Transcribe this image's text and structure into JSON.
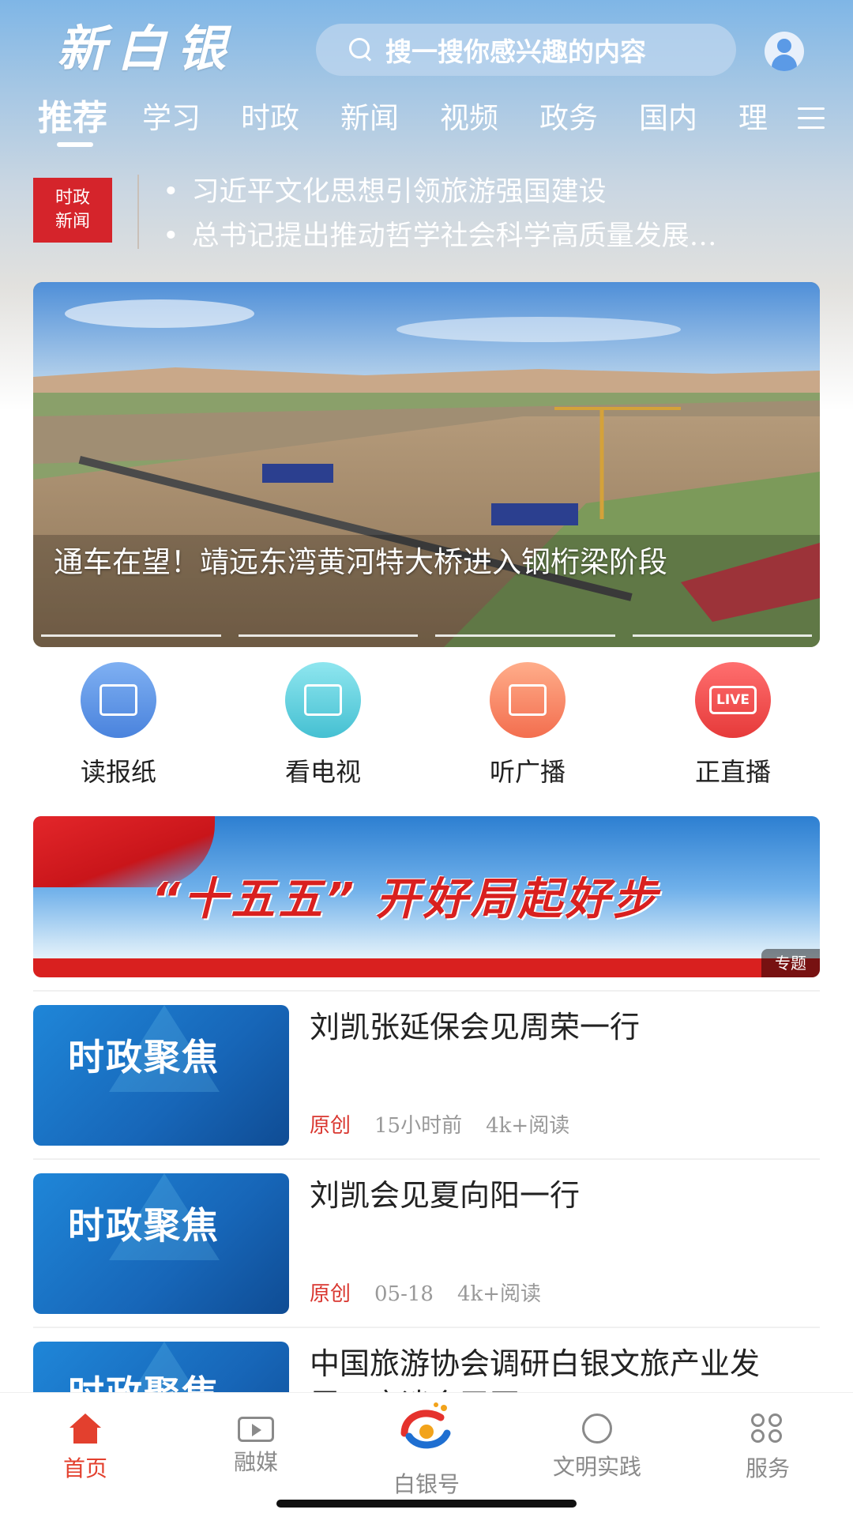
{
  "header": {
    "logo_text": "新白银",
    "search_placeholder": "搜一搜你感兴趣的内容"
  },
  "tabs": [
    {
      "label": "推荐",
      "active": true
    },
    {
      "label": "学习"
    },
    {
      "label": "时政"
    },
    {
      "label": "新闻"
    },
    {
      "label": "视频"
    },
    {
      "label": "政务"
    },
    {
      "label": "国内"
    },
    {
      "label": "理"
    }
  ],
  "ticker": {
    "badge_line1": "时政",
    "badge_line2": "新闻",
    "items": [
      "习近平文化思想引领旅游强国建设",
      "总书记提出推动哲学社会科学高质量发展…"
    ]
  },
  "hero": {
    "caption": "通车在望！靖远东湾黄河特大桥进入钢桁梁阶段",
    "slide_count": 4
  },
  "quick_entries": [
    {
      "label": "读报纸",
      "icon": "newspaper-icon",
      "color": "#4a83dd"
    },
    {
      "label": "看电视",
      "icon": "tv-icon",
      "color": "#45c0d2"
    },
    {
      "label": "听广播",
      "icon": "radio-icon",
      "color": "#f36e4f"
    },
    {
      "label": "正直播",
      "icon": "live-icon",
      "badge": "LIVE",
      "color": "#e63a3a"
    }
  ],
  "topic_banner": {
    "title": "“十五五” 开好局起好步",
    "tag": "专题"
  },
  "articles": [
    {
      "thumb_text": "时政聚焦",
      "title": "刘凯张延保会见周荣一行",
      "source": "原创",
      "time": "15小时前",
      "reads": "4k+阅读"
    },
    {
      "thumb_text": "时政聚焦",
      "title": "刘凯会见夏向阳一行",
      "source": "原创",
      "time": "05-18",
      "reads": "4k+阅读"
    },
    {
      "thumb_text": "时政聚焦",
      "title": "中国旅游协会调研白银文旅产业发展…座谈会召开",
      "source": "",
      "time": "",
      "reads": ""
    }
  ],
  "bottom_nav": [
    {
      "label": "首页",
      "icon": "home-icon",
      "active": true
    },
    {
      "label": "融媒",
      "icon": "media-play-icon"
    },
    {
      "label": "白银号",
      "icon": "baiyin-logo-icon"
    },
    {
      "label": "文明实践",
      "icon": "civilization-practice-icon"
    },
    {
      "label": "服务",
      "icon": "service-grid-icon"
    }
  ],
  "colors": {
    "accent_red": "#d5242b",
    "nav_active": "#e3402e",
    "meta_gray": "#999999"
  }
}
